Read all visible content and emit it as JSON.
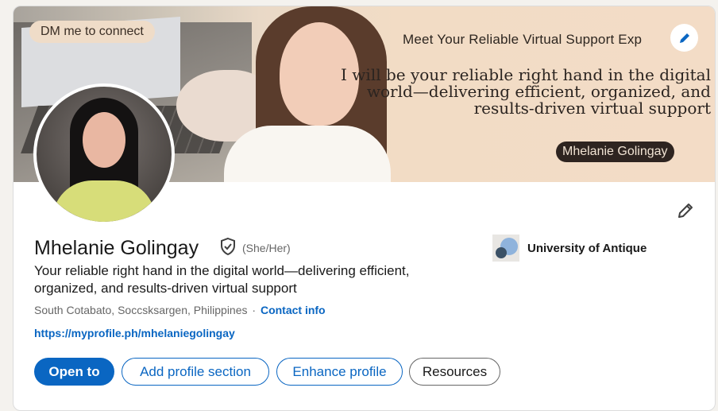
{
  "banner": {
    "dm_label": "DM me to connect",
    "meet_text": "Meet Your Reliable Virtual Support Exp",
    "tagline": "I will be your reliable right hand in the digital world—delivering efficient, organized, and results-driven virtual support",
    "name_badge": "Mhelanie Golingay",
    "edit_icon": "pencil-icon"
  },
  "profile": {
    "name": "Mhelanie Golingay",
    "verified_icon": "shield-check-icon",
    "pronouns": "(She/Her)",
    "headline": "Your reliable right hand in the digital world—delivering efficient, organized, and results-driven virtual support",
    "location": "South Cotabato, Soccsksargen, Philippines",
    "separator": "·",
    "contact_label": "Contact info",
    "website": "https://myprofile.ph/mhelaniegolingay",
    "edit_icon": "pencil-icon"
  },
  "education": {
    "school": "University of Antique"
  },
  "actions": {
    "open_to": "Open to",
    "add_section": "Add profile section",
    "enhance": "Enhance profile",
    "resources": "Resources"
  },
  "colors": {
    "accent": "#0a66c2",
    "banner_bg": "#f2dcc5"
  }
}
